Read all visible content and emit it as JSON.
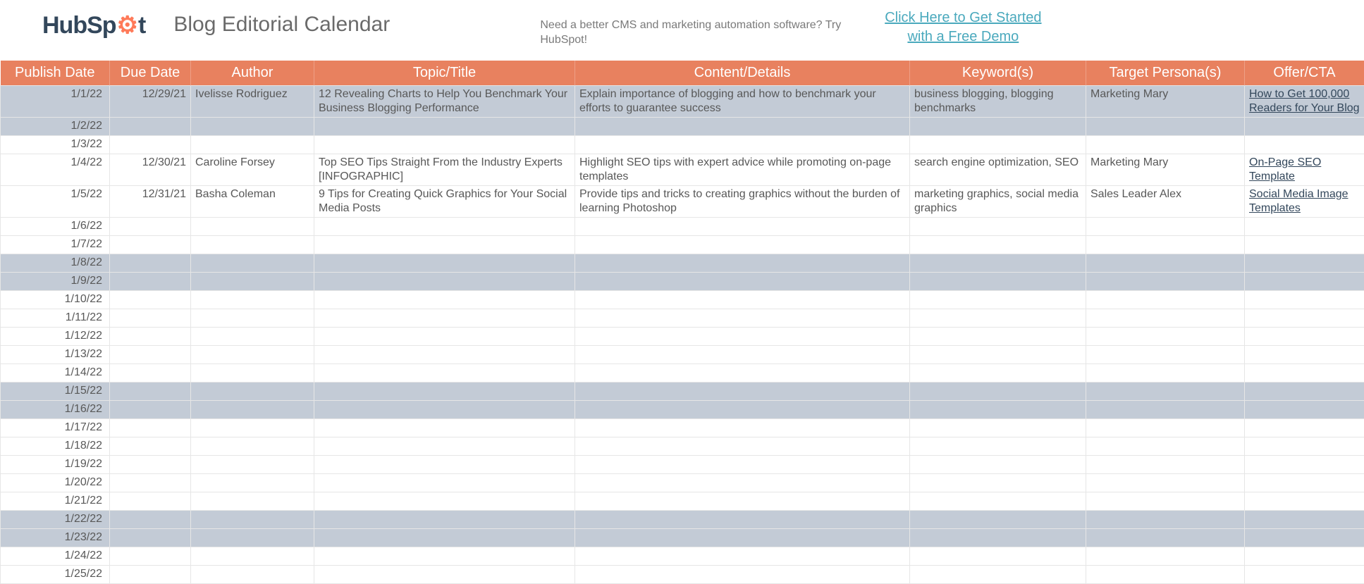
{
  "header": {
    "logo_left": "HubSp",
    "logo_right": "t",
    "title": "Blog Editorial Calendar",
    "tagline": "Need a better CMS and marketing automation software? Try HubSpot!",
    "cta": "Click Here to Get Started with a Free Demo"
  },
  "columns": {
    "publish": "Publish Date",
    "due": "Due Date",
    "author": "Author",
    "topic": "Topic/Title",
    "content": "Content/Details",
    "keywords": "Keyword(s)",
    "persona": "Target Persona(s)",
    "offer": "Offer/CTA"
  },
  "rows": [
    {
      "publish": "1/1/22",
      "due": "12/29/21",
      "author": "Ivelisse Rodriguez",
      "topic": "12 Revealing Charts to Help You Benchmark Your Business Blogging Performance",
      "content": "Explain importance of blogging and how to benchmark your efforts to guarantee success",
      "keywords": "business blogging, blogging benchmarks",
      "persona": "Marketing Mary",
      "offer": "How to Get 100,000 Readers for Your Blog",
      "offer_link": true,
      "weekend": true
    },
    {
      "publish": "1/2/22",
      "weekend": true
    },
    {
      "publish": "1/3/22"
    },
    {
      "publish": "1/4/22",
      "due": "12/30/21",
      "author": "Caroline Forsey",
      "topic": "Top SEO Tips Straight From the Industry Experts [INFOGRAPHIC]",
      "content": "Highlight SEO tips with expert advice while promoting on-page templates",
      "keywords": "search engine optimization, SEO",
      "persona": "Marketing Mary",
      "offer": "On-Page SEO Template",
      "offer_link": true
    },
    {
      "publish": "1/5/22",
      "due": "12/31/21",
      "author": "Basha Coleman",
      "topic": "9 Tips for Creating Quick Graphics for Your Social Media Posts",
      "content": "Provide tips and tricks to creating graphics without the burden of learning Photoshop",
      "keywords": "marketing graphics, social media graphics",
      "persona": "Sales Leader Alex",
      "offer": "Social Media Image Templates",
      "offer_link": true
    },
    {
      "publish": "1/6/22"
    },
    {
      "publish": "1/7/22"
    },
    {
      "publish": "1/8/22",
      "weekend": true
    },
    {
      "publish": "1/9/22",
      "weekend": true
    },
    {
      "publish": "1/10/22"
    },
    {
      "publish": "1/11/22"
    },
    {
      "publish": "1/12/22"
    },
    {
      "publish": "1/13/22"
    },
    {
      "publish": "1/14/22"
    },
    {
      "publish": "1/15/22",
      "weekend": true
    },
    {
      "publish": "1/16/22",
      "weekend": true
    },
    {
      "publish": "1/17/22"
    },
    {
      "publish": "1/18/22"
    },
    {
      "publish": "1/19/22"
    },
    {
      "publish": "1/20/22"
    },
    {
      "publish": "1/21/22"
    },
    {
      "publish": "1/22/22",
      "weekend": true
    },
    {
      "publish": "1/23/22",
      "weekend": true
    },
    {
      "publish": "1/24/22"
    },
    {
      "publish": "1/25/22"
    }
  ]
}
